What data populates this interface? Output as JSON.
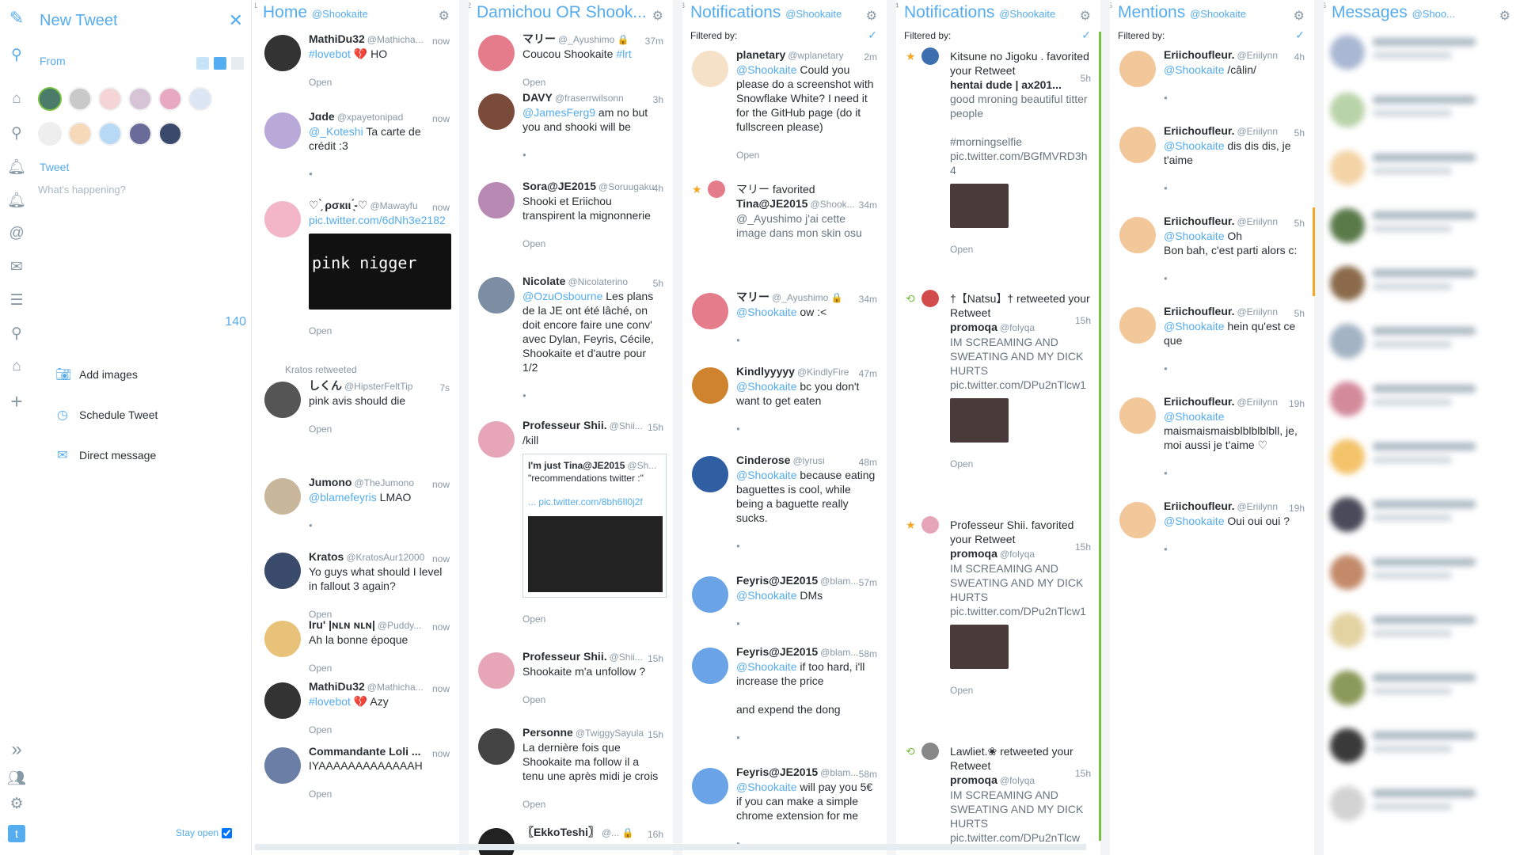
{
  "rail": {
    "icons": [
      "logo-icon",
      "search-icon",
      "home-icon",
      "search-icon",
      "bell-icon",
      "bell-icon",
      "at-icon",
      "mail-icon",
      "lists-icon",
      "search-icon",
      "home-icon",
      "add-icon"
    ],
    "bottom_icons": [
      "expand-icon",
      "accounts-icon",
      "settings-icon",
      "twitter-icon"
    ]
  },
  "compose": {
    "title": "New Tweet",
    "from_label": "From",
    "tweet_label": "Tweet",
    "placeholder": "What's happening?",
    "char_count": "140",
    "add_images": "Add images",
    "schedule": "Schedule Tweet",
    "direct_message": "Direct message",
    "stay_open": "Stay open"
  },
  "columns": [
    {
      "num": "1",
      "title": "Home",
      "account": "@Shookaite"
    },
    {
      "num": "2",
      "title": "Damichou OR Shook...",
      "account": ""
    },
    {
      "num": "3",
      "title": "Notifications",
      "account": "@Shookaite",
      "filtered": "Filtered by:"
    },
    {
      "num": "4",
      "title": "Notifications",
      "account": "@Shookaite",
      "filtered": "Filtered by:"
    },
    {
      "num": "5",
      "title": "Mentions",
      "account": "@Shookaite",
      "filtered": "Filtered by:"
    },
    {
      "num": "6",
      "title": "Messages",
      "account": "@Shoo..."
    }
  ],
  "home": [
    {
      "name": "MathiDu32",
      "handle": "@Mathicha...",
      "time": "now",
      "link": "#lovebot",
      "text": " 💔 HO",
      "meta": "Open",
      "color": "#333"
    },
    {
      "name": "Jɑde",
      "handle": "@xpayetonipad",
      "time": "now",
      "link": "@_Koteshi",
      "text": " Ta carte de crédit :3",
      "meta": "",
      "color": "#b9a9d8"
    },
    {
      "name": "♡ ̗̀ ρσкιι ̖́-♡",
      "handle": "@Mawayfu",
      "time": "now",
      "link": "pic.twitter.com/6dNh3e2182",
      "text": "",
      "meta": "Open",
      "color": "#f3b5c8"
    },
    {
      "name": "しくん",
      "handle": "@HipsterFeltTip",
      "time": "7s",
      "link": "",
      "text": "pink avis should die",
      "meta": "Open",
      "color": "#555",
      "rt": "Kratos retweeted"
    },
    {
      "name": "Jumono",
      "handle": "@TheJumono",
      "time": "now",
      "link": "@blamefeyris",
      "text": " LMAO",
      "meta": "",
      "color": "#c9b79c"
    },
    {
      "name": "Kratos",
      "handle": "@KratosAur12000",
      "time": "now",
      "link": "",
      "text": "Yo guys what should I level in fallout 3 again?",
      "meta": "Open",
      "color": "#3a4a6b"
    },
    {
      "name": "Iru' |ɴʟɴ ɴʟɴ|",
      "handle": "@Puddy...",
      "time": "now",
      "link": "",
      "text": "Ah la bonne époque",
      "meta": "Open",
      "color": "#e9c27a"
    },
    {
      "name": "MathiDu32",
      "handle": "@Mathicha...",
      "time": "now",
      "link": "#lovebot",
      "text": " 💔 Azy",
      "meta": "Open",
      "color": "#333"
    },
    {
      "name": "Commandante Loli ...",
      "handle": "",
      "time": "now",
      "link": "",
      "text": "IYAAAAAAAAAAAAAH",
      "meta": "Open",
      "color": "#6a7ea6"
    }
  ],
  "media_text": {
    "line1": "pink",
    "line2": "nigger"
  },
  "search": [
    {
      "name": "マリー",
      "handle": "@_Ayushimo 🔒",
      "time": "37m",
      "link": "",
      "text": "Coucou Shookaite ",
      "tag": "#lrt",
      "meta": "Open",
      "color": "#e57c8c"
    },
    {
      "name": "DAVY",
      "handle": "@fraserrwilsonn",
      "time": "3h",
      "link": "@JamesFerg9",
      "text": " am no but you and shooki will be",
      "meta": "",
      "color": "#7a4a3a"
    },
    {
      "name": "Sora@JE2015",
      "handle": "@Soruugaku",
      "time": "4h",
      "link": "",
      "text": "Shooki et Eriichou transpirent la mignonnerie",
      "meta": "Open",
      "color": "#b88ab3"
    },
    {
      "name": "Nicolate",
      "handle": "@Nicolaterino",
      "time": "5h",
      "link": "@OzuOsbourne",
      "text": " Les plans de la JE ont été lâché, on doit encore faire une conv' avec Dylan, Feyris, Cécile, Shookaite et d'autre pour 1/2",
      "meta": "",
      "color": "#7c8ea3"
    },
    {
      "name": "Professeur Shii.",
      "handle": "@Shii...",
      "time": "15h",
      "link": "",
      "text": "/kill",
      "meta": "Open",
      "color": "#e6a6b8"
    },
    {
      "name": "Professeur Shii.",
      "handle": "@Shii...",
      "time": "15h",
      "link": "",
      "text": "Shookaite m'a unfollow ?",
      "meta": "Open",
      "color": "#e6a6b8"
    },
    {
      "name": "Personne",
      "handle": "@TwiggySayula",
      "time": "15h",
      "link": "",
      "text": "La dernière fois que Shookaite ma follow il a tenu une après midi je crois",
      "meta": "Open",
      "color": "#444"
    },
    {
      "name": "〖EkkoTeshi〗",
      "handle": "@... 🔒",
      "time": "16h",
      "link": "",
      "text": "",
      "meta": "",
      "color": "#222"
    }
  ],
  "quote_card": {
    "name": "I'm just Tina@JE2015",
    "handle": "@Sh...",
    "text": "\"recommendations twitter :\"",
    "link": "... pic.twitter.com/8bh6Il0j2f"
  },
  "notif1": [
    {
      "name": "planetary",
      "handle": "@wplanetary",
      "time": "2m",
      "link": "@Shookaite",
      "text": " Could you please do a screenshot with Snowflake White? I need it for the GitHub page (do it fullscreen please)",
      "meta": "Open",
      "color": "#f5e1c8"
    },
    {
      "kind": "fav",
      "line": "マリー favorited",
      "name": "Tina@JE2015",
      "handle": "@Shook...",
      "time": "34m",
      "text": "@_Ayushimo j'ai cette image dans mon skin osu",
      "color": "#e57c8c"
    },
    {
      "name": "マリー",
      "handle": "@_Ayushimo 🔒",
      "time": "34m",
      "link": "@Shookaite",
      "text": " ow :<",
      "meta": "",
      "color": "#e57c8c"
    },
    {
      "name": "Kindlyyyyy",
      "handle": "@KindlyFire",
      "time": "47m",
      "link": "@Shookaite",
      "text": " bc you don't want to get eaten",
      "meta": "",
      "color": "#d0832f"
    },
    {
      "name": "Cinderose",
      "handle": "@lyrusi",
      "time": "48m",
      "link": "@Shookaite",
      "text": " because eating baguettes is cool, while being a baguette really sucks.",
      "meta": "",
      "color": "#2f5ea3"
    },
    {
      "name": "Feyris@JE2015",
      "handle": "@blam...",
      "time": "57m",
      "link": "@Shookaite",
      "text": " DMs",
      "meta": "",
      "color": "#6aa3e6"
    },
    {
      "name": "Feyris@JE2015",
      "handle": "@blam...",
      "time": "58m",
      "link": "@Shookaite",
      "text": " if too hard, i'll increase the price\n\nand expend the dong",
      "meta": "",
      "color": "#6aa3e6"
    },
    {
      "name": "Feyris@JE2015",
      "handle": "@blam...",
      "time": "58m",
      "link": "@Shookaite",
      "text": " will pay you 5€ if you can make a simple chrome extension for me",
      "meta": "",
      "color": "#6aa3e6"
    }
  ],
  "notif2": [
    {
      "kind": "fav",
      "line": "Kitsune no Jigoku . favorited your Retweet",
      "name": "hentai dude | ax201...",
      "time": "5h",
      "text": "good mroning beautiful titter people\n\n#morningselfie pic.twitter.com/BGfMVRD3h4",
      "media": true,
      "color": "#3d6fb0"
    },
    {
      "kind": "rt",
      "line": "†【Natsu】† retweeted your Retweet",
      "name": "promoqa",
      "handle": "@folyqa",
      "time": "15h",
      "text": "IM SCREAMING AND SWEATING AND MY DICK HURTS pic.twitter.com/DPu2nTlcw1",
      "media": true,
      "color": "#d24c4c"
    },
    {
      "kind": "fav",
      "line": "Professeur Shii. favorited your Retweet",
      "name": "promoqa",
      "handle": "@folyqa",
      "time": "15h",
      "text": "IM SCREAMING AND SWEATING AND MY DICK HURTS pic.twitter.com/DPu2nTlcw1",
      "media": true,
      "color": "#e6a6b8"
    },
    {
      "kind": "rt",
      "line": "Lawliet.❀ retweeted your Retweet",
      "name": "promoqa",
      "handle": "@folyqa",
      "time": "15h",
      "text": "IM SCREAMING AND SWEATING AND MY DICK HURTS pic.twitter.com/DPu2nTlcw",
      "media": false,
      "color": "#888"
    }
  ],
  "mentions": [
    {
      "name": "Eriichoufleur.",
      "handle": "@Eriilynn",
      "time": "4h",
      "link": "@Shookaite",
      "text": " /câlin/"
    },
    {
      "name": "Eriichoufleur.",
      "handle": "@Eriilynn",
      "time": "5h",
      "link": "@Shookaite",
      "text": " dis dis dis, je t'aime"
    },
    {
      "name": "Eriichoufleur.",
      "handle": "@Eriilynn",
      "time": "5h",
      "link": "@Shookaite",
      "text": " Oh\nBon bah, c'est parti alors c:"
    },
    {
      "name": "Eriichoufleur.",
      "handle": "@Eriilynn",
      "time": "5h",
      "link": "@Shookaite",
      "text": " hein qu'est ce que"
    },
    {
      "name": "Eriichoufleur.",
      "handle": "@Eriilynn",
      "time": "19h",
      "link": "@Shookaite",
      "text": " maismaismaisblblblblbll, je, moi aussi je t'aime ♡"
    },
    {
      "name": "Eriichoufleur.",
      "handle": "@Eriilynn",
      "time": "19h",
      "link": "@Shookaite",
      "text": " Oui oui oui ?"
    }
  ],
  "messages_count": 14,
  "colors": {
    "accent": "#55acee",
    "text": "#292f33",
    "muted": "#8899a6",
    "green": "#7ac143",
    "orange": "#f5a623"
  }
}
